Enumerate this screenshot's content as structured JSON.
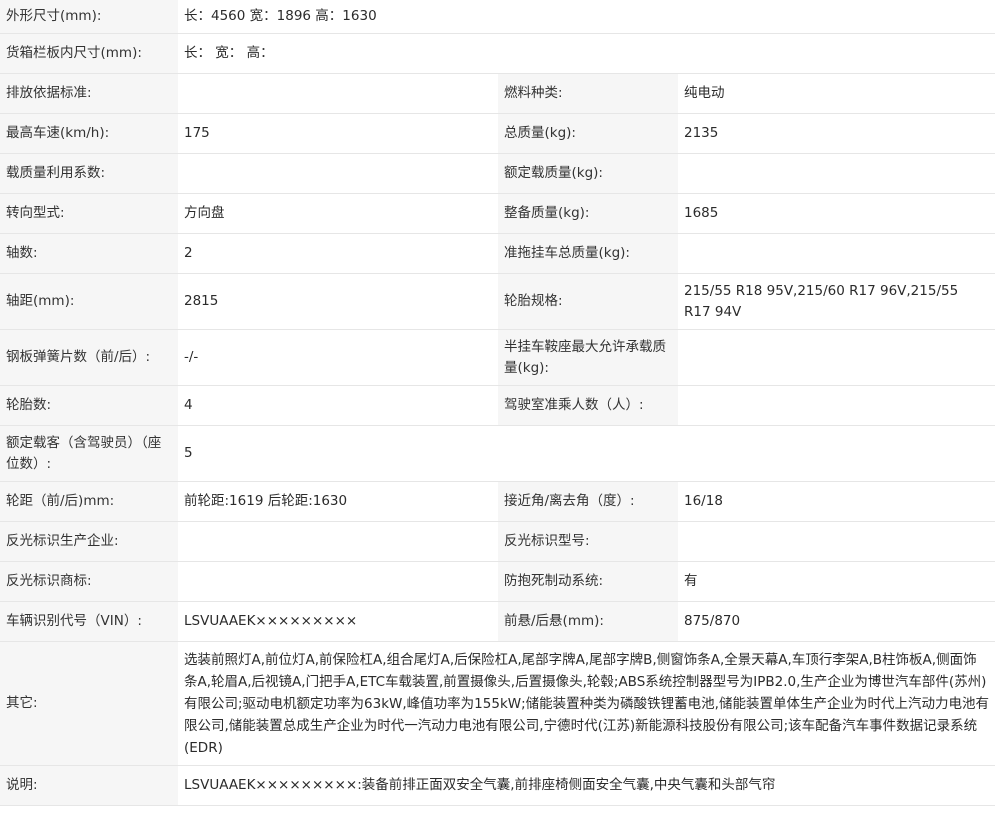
{
  "rows": {
    "dims": {
      "label": "外形尺寸(mm):",
      "value": "长：4560 宽：1896 高：1630"
    },
    "cargo": {
      "label": "货箱栏板内尺寸(mm):",
      "value": "长：  宽：  高："
    },
    "emission": {
      "label": "排放依据标准:",
      "value": "",
      "label2": "燃料种类:",
      "value2": "纯电动"
    },
    "speed": {
      "label": "最高车速(km/h):",
      "value": "175",
      "label2": "总质量(kg):",
      "value2": "2135"
    },
    "loadutil": {
      "label": "载质量利用系数:",
      "value": "",
      "label2": "额定载质量(kg):",
      "value2": ""
    },
    "steering": {
      "label": "转向型式:",
      "value": "方向盘",
      "label2": "整备质量(kg):",
      "value2": "1685"
    },
    "axles": {
      "label": "轴数:",
      "value": "2",
      "label2": "准拖挂车总质量(kg):",
      "value2": ""
    },
    "wheelbase": {
      "label": "轴距(mm):",
      "value": "2815",
      "label2": "轮胎规格:",
      "value2": "215/55 R18 95V,215/60 R17 96V,215/55 R17 94V"
    },
    "springs": {
      "label": "钢板弹簧片数（前/后）:",
      "value": "-/-",
      "label2": "半挂车鞍座最大允许承载质量(kg):",
      "value2": ""
    },
    "tires": {
      "label": "轮胎数:",
      "value": "4",
      "label2": "驾驶室准乘人数（人）:",
      "value2": ""
    },
    "passengers": {
      "label": "额定载客（含驾驶员）（座位数）:",
      "value": "5"
    },
    "track": {
      "label": "轮距（前/后)mm:",
      "value": "前轮距:1619 后轮距:1630",
      "label2": "接近角/离去角（度）:",
      "value2": "16/18"
    },
    "reflector_maker": {
      "label": "反光标识生产企业:",
      "value": "",
      "label2": "反光标识型号:",
      "value2": ""
    },
    "reflector_brand": {
      "label": "反光标识商标:",
      "value": "",
      "label2": "防抱死制动系统:",
      "value2": "有"
    },
    "vin": {
      "label": "车辆识别代号（VIN）:",
      "value": "LSVUAAEK×××××××××",
      "label2": "前悬/后悬(mm):",
      "value2": "875/870"
    },
    "other": {
      "label": "其它:",
      "value": "选装前照灯A,前位灯A,前保险杠A,组合尾灯A,后保险杠A,尾部字牌A,尾部字牌B,侧窗饰条A,全景天幕A,车顶行李架A,B柱饰板A,侧面饰条A,轮眉A,后视镜A,门把手A,ETC车载装置,前置摄像头,后置摄像头,轮毂;ABS系统控制器型号为IPB2.0,生产企业为博世汽车部件(苏州)有限公司;驱动电机额定功率为63kW,峰值功率为155kW;储能装置种类为磷酸铁锂蓄电池,储能装置单体生产企业为时代上汽动力电池有限公司,储能装置总成生产企业为时代一汽动力电池有限公司,宁德时代(江苏)新能源科技股份有限公司;该车配备汽车事件数据记录系统(EDR)"
    },
    "notes": {
      "label": "说明:",
      "value": "LSVUAAEK×××××××××:装备前排正面双安全气囊,前排座椅侧面安全气囊,中央气囊和头部气帘"
    }
  }
}
